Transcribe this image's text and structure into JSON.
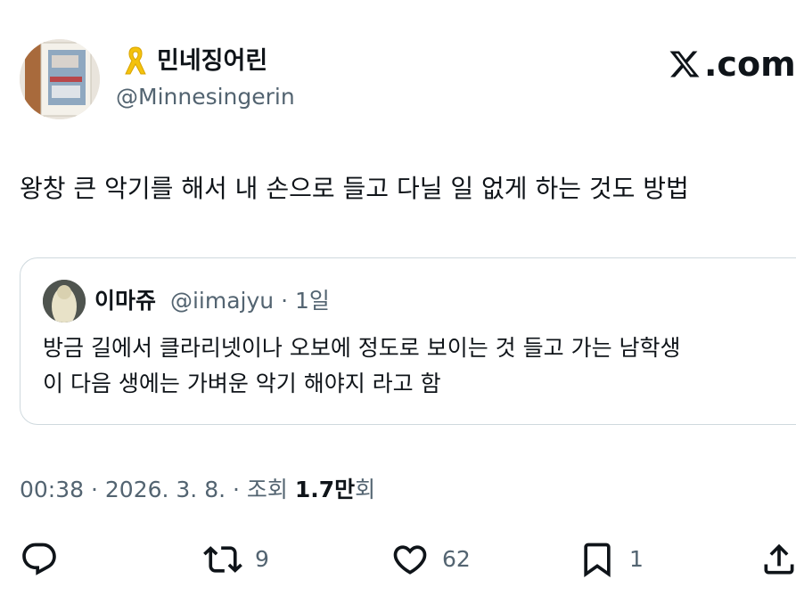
{
  "author": {
    "display_name": "민네징어린",
    "handle": "@Minnesingerin",
    "badge_icon": "yellow-ribbon-icon",
    "ribbon_color": "#f4c20d"
  },
  "brand": {
    "logo_icon": "x-logo-icon",
    "logo_text": ".com"
  },
  "tweet": {
    "text": "왕창 큰 악기를 해서 내 손으로 들고 다닐 일 없게 하는 것도 방법"
  },
  "quote": {
    "display_name": "이마쥬",
    "handle": "@iimajyu",
    "separator": " · ",
    "time": "1일",
    "lines": [
      "방금 길에서 클라리넷이나 오보에 정도로 보이는 것 들고 가는 남학생",
      "이 다음 생에는 가벼운 악기 해야지 라고 함"
    ]
  },
  "meta": {
    "timestamp": "00:38 · 2026. 3. 8. · 조회 ",
    "views_count": "1.7만",
    "views_suffix": "회"
  },
  "actions": {
    "reply": {
      "icon": "reply-icon",
      "count": ""
    },
    "retweet": {
      "icon": "retweet-icon",
      "count": "9"
    },
    "like": {
      "icon": "heart-icon",
      "count": "62"
    },
    "bookmark": {
      "icon": "bookmark-icon",
      "count": "1"
    },
    "share": {
      "icon": "share-icon",
      "count": ""
    }
  },
  "colors": {
    "text_primary": "#0f1419",
    "text_secondary": "#536471",
    "border": "#cfd9de"
  }
}
